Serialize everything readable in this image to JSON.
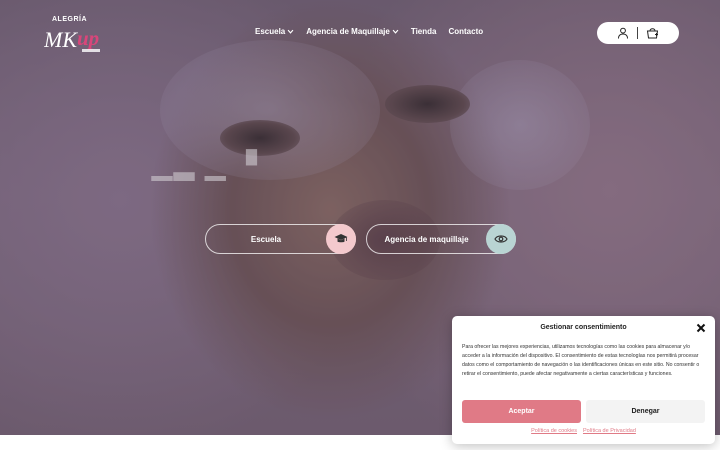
{
  "colors": {
    "accent_pink": "#e07a86",
    "cta_pink_circle": "#f4c9cd",
    "cta_mint_circle": "#b9d4d3",
    "logo_pink": "#d9467a"
  },
  "logo": {
    "top_text": "ALEGRÍA",
    "icon": "mkup-logo"
  },
  "nav": {
    "items": [
      {
        "label": "Escuela",
        "has_dropdown": true
      },
      {
        "label": "Agencia de Maquillaje",
        "has_dropdown": true
      },
      {
        "label": "Tienda",
        "has_dropdown": false
      },
      {
        "label": "Contacto",
        "has_dropdown": false
      }
    ]
  },
  "header_actions": {
    "account_icon": "user-icon",
    "cart_icon": "cart-icon"
  },
  "hero": {
    "buttons": [
      {
        "label": "Escuela",
        "icon": "graduation-cap-icon"
      },
      {
        "label": "Agencia de maquillaje",
        "icon": "eye-icon"
      }
    ]
  },
  "consent": {
    "title": "Gestionar consentimiento",
    "body": "Para ofrecer las mejores experiencias, utilizamos tecnologías como las cookies para almacenar y/o acceder a la información del dispositivo. El consentimiento de estas tecnologías nos permitirá procesar datos como el comportamiento de navegación o las identificaciones únicas en este sitio. No consentir o retirar el consentimiento, puede afectar negativamente a ciertas características y funciones.",
    "accept_label": "Aceptar",
    "deny_label": "Denegar",
    "links": [
      "Política de cookies",
      "Política de Privacidad"
    ]
  }
}
